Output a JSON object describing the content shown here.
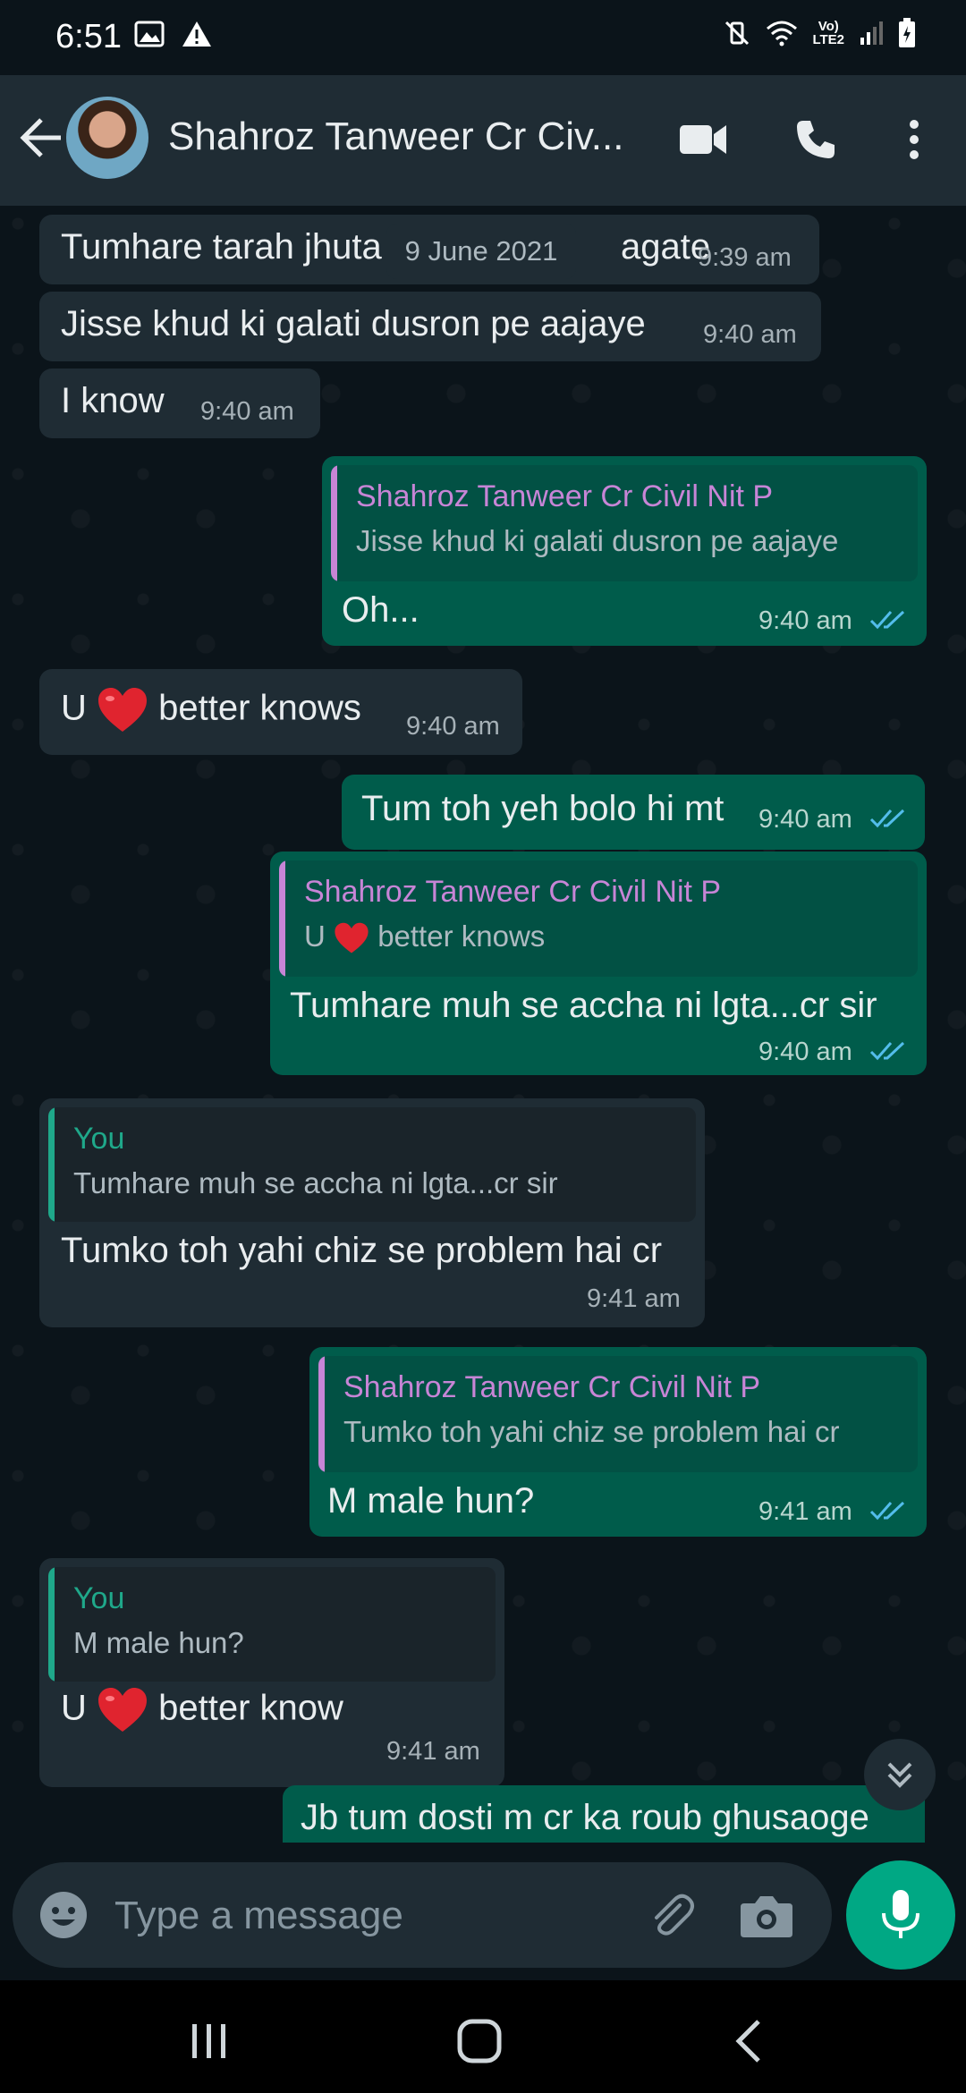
{
  "status_bar": {
    "time": "6:51",
    "network_label_top": "Vo)",
    "network_label_bottom": "LTE2"
  },
  "header": {
    "contact_name": "Shahroz Tanweer Cr Civ...",
    "icons": [
      "back-arrow-icon",
      "video-call-icon",
      "phone-icon",
      "more-vertical-icon"
    ]
  },
  "chat": {
    "date_chip": "9 June 2021",
    "messages": [
      {
        "direction": "in",
        "text": "Tumhare tarah jhuta",
        "text_tail": "agate",
        "time": "9:39 am"
      },
      {
        "direction": "in",
        "text": "Jisse khud ki galati dusron pe aajaye",
        "time": "9:40 am"
      },
      {
        "direction": "in",
        "text": "I know",
        "time": "9:40 am"
      },
      {
        "direction": "out",
        "quote_author": "Shahroz Tanweer Cr Civil Nit P",
        "quote_text": "Jisse khud ki galati dusron pe aajaye",
        "text": "Oh...",
        "time": "9:40 am",
        "status": "read"
      },
      {
        "direction": "in",
        "text_before": "U",
        "text_after": "better knows",
        "time": "9:40 am"
      },
      {
        "direction": "out",
        "text": "Tum toh yeh bolo hi mt",
        "time": "9:40 am",
        "status": "read"
      },
      {
        "direction": "out",
        "quote_author": "Shahroz Tanweer Cr Civil Nit P",
        "quote_before": "U",
        "quote_after": "better knows",
        "text": "Tumhare muh se accha ni lgta...cr sir",
        "time": "9:40 am",
        "status": "read"
      },
      {
        "direction": "in",
        "quote_author": "You",
        "quote_text": "Tumhare muh se accha ni lgta...cr sir",
        "text": "Tumko toh yahi chiz se problem hai cr",
        "time": "9:41 am"
      },
      {
        "direction": "out",
        "quote_author": "Shahroz Tanweer Cr Civil Nit P",
        "quote_text": "Tumko toh yahi chiz se problem hai cr",
        "text": "M male hun?",
        "time": "9:41 am",
        "status": "read"
      },
      {
        "direction": "in",
        "quote_author": "You",
        "quote_text": "M male hun?",
        "text_before": "U",
        "text_after": "better know",
        "time": "9:41 am"
      },
      {
        "direction": "out",
        "text": "Jb tum dosti m cr ka roub ghusaoge"
      }
    ]
  },
  "composer": {
    "placeholder": "Type a message"
  },
  "colors": {
    "background": "#0b141a",
    "header": "#1f2c34",
    "incoming_bubble": "#1f2c34",
    "outgoing_bubble": "#005c4b",
    "accent": "#00a884",
    "quote_author_out": "#c785d6",
    "quote_author_in": "#1fa88a",
    "read_ticks": "#53bdeb"
  }
}
